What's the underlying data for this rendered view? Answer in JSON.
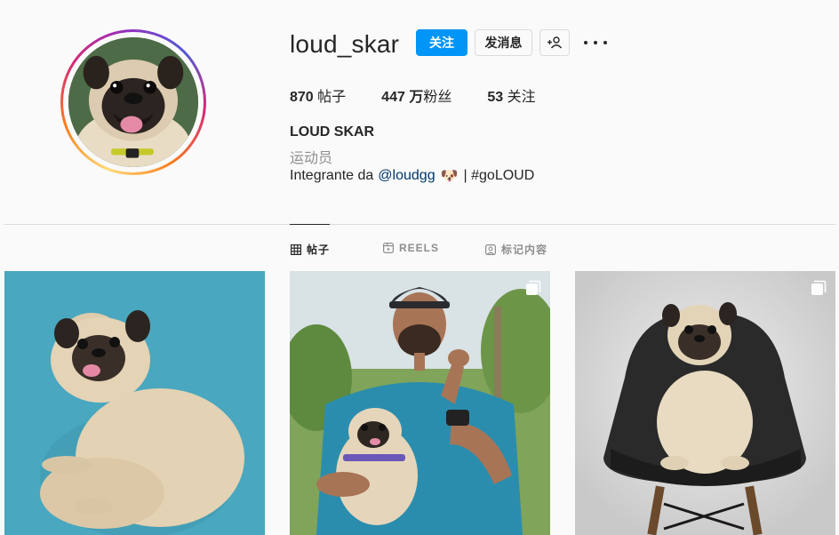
{
  "profile": {
    "username": "loud_skar",
    "full_name": "LOUD SKAR",
    "category": "运动员",
    "bio": {
      "prefix": "Integrante da",
      "mention": "@loudgg",
      "emoji": "🐶",
      "suffix": "| #goLOUD"
    },
    "avatar_icon": "pug-avatar"
  },
  "actions": {
    "follow_label": "关注",
    "message_label": "发消息",
    "suggest_icon": "add-person-icon",
    "more_icon": "more-options-icon"
  },
  "stats": {
    "posts_count": "870",
    "posts_label": "帖子",
    "followers_count": "447 万",
    "followers_label": "粉丝",
    "following_count": "53",
    "following_label": "关注"
  },
  "tabs": [
    {
      "label": "帖子",
      "icon": "grid-icon",
      "active": true
    },
    {
      "label": "REELS",
      "icon": "reels-icon",
      "active": false
    },
    {
      "label": "标记内容",
      "icon": "tagged-icon",
      "active": false
    }
  ],
  "posts": [
    {
      "description": "pug-on-blue-background",
      "multi": false
    },
    {
      "description": "man-holding-pug-outdoors",
      "multi": true
    },
    {
      "description": "pug-on-black-chair",
      "multi": true
    }
  ],
  "colors": {
    "accent": "#0095f6",
    "text": "#262626",
    "secondary": "#8e8e8e",
    "border": "#dbdbdb",
    "background": "#fafafa",
    "mention": "#00376b"
  }
}
